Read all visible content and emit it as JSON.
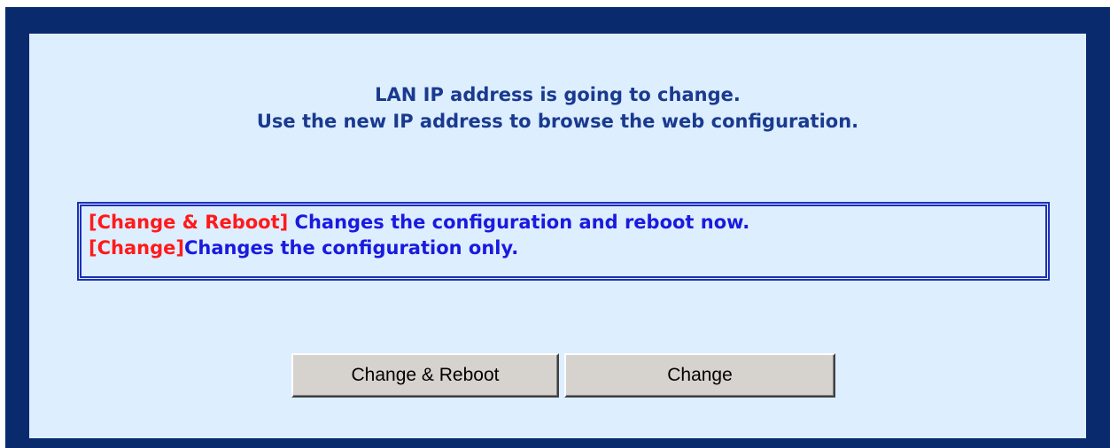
{
  "message": {
    "line1": "LAN IP address is going to change.",
    "line2": "Use the new IP address to browse the web configuration."
  },
  "info": {
    "items": [
      {
        "tag": "[Change & Reboot]",
        "description": " Changes the configuration and reboot now."
      },
      {
        "tag": "[Change]",
        "description": "Changes the configuration only."
      }
    ]
  },
  "buttons": {
    "change_reboot_label": "Change & Reboot",
    "change_label": "Change"
  },
  "colors": {
    "frame": "#0a2a6e",
    "panel": "#ddeeff",
    "message_text": "#1a3a8f",
    "tag_text": "#ff1a1a",
    "description_text": "#1a1adf",
    "button_face": "#d6d3ce"
  }
}
